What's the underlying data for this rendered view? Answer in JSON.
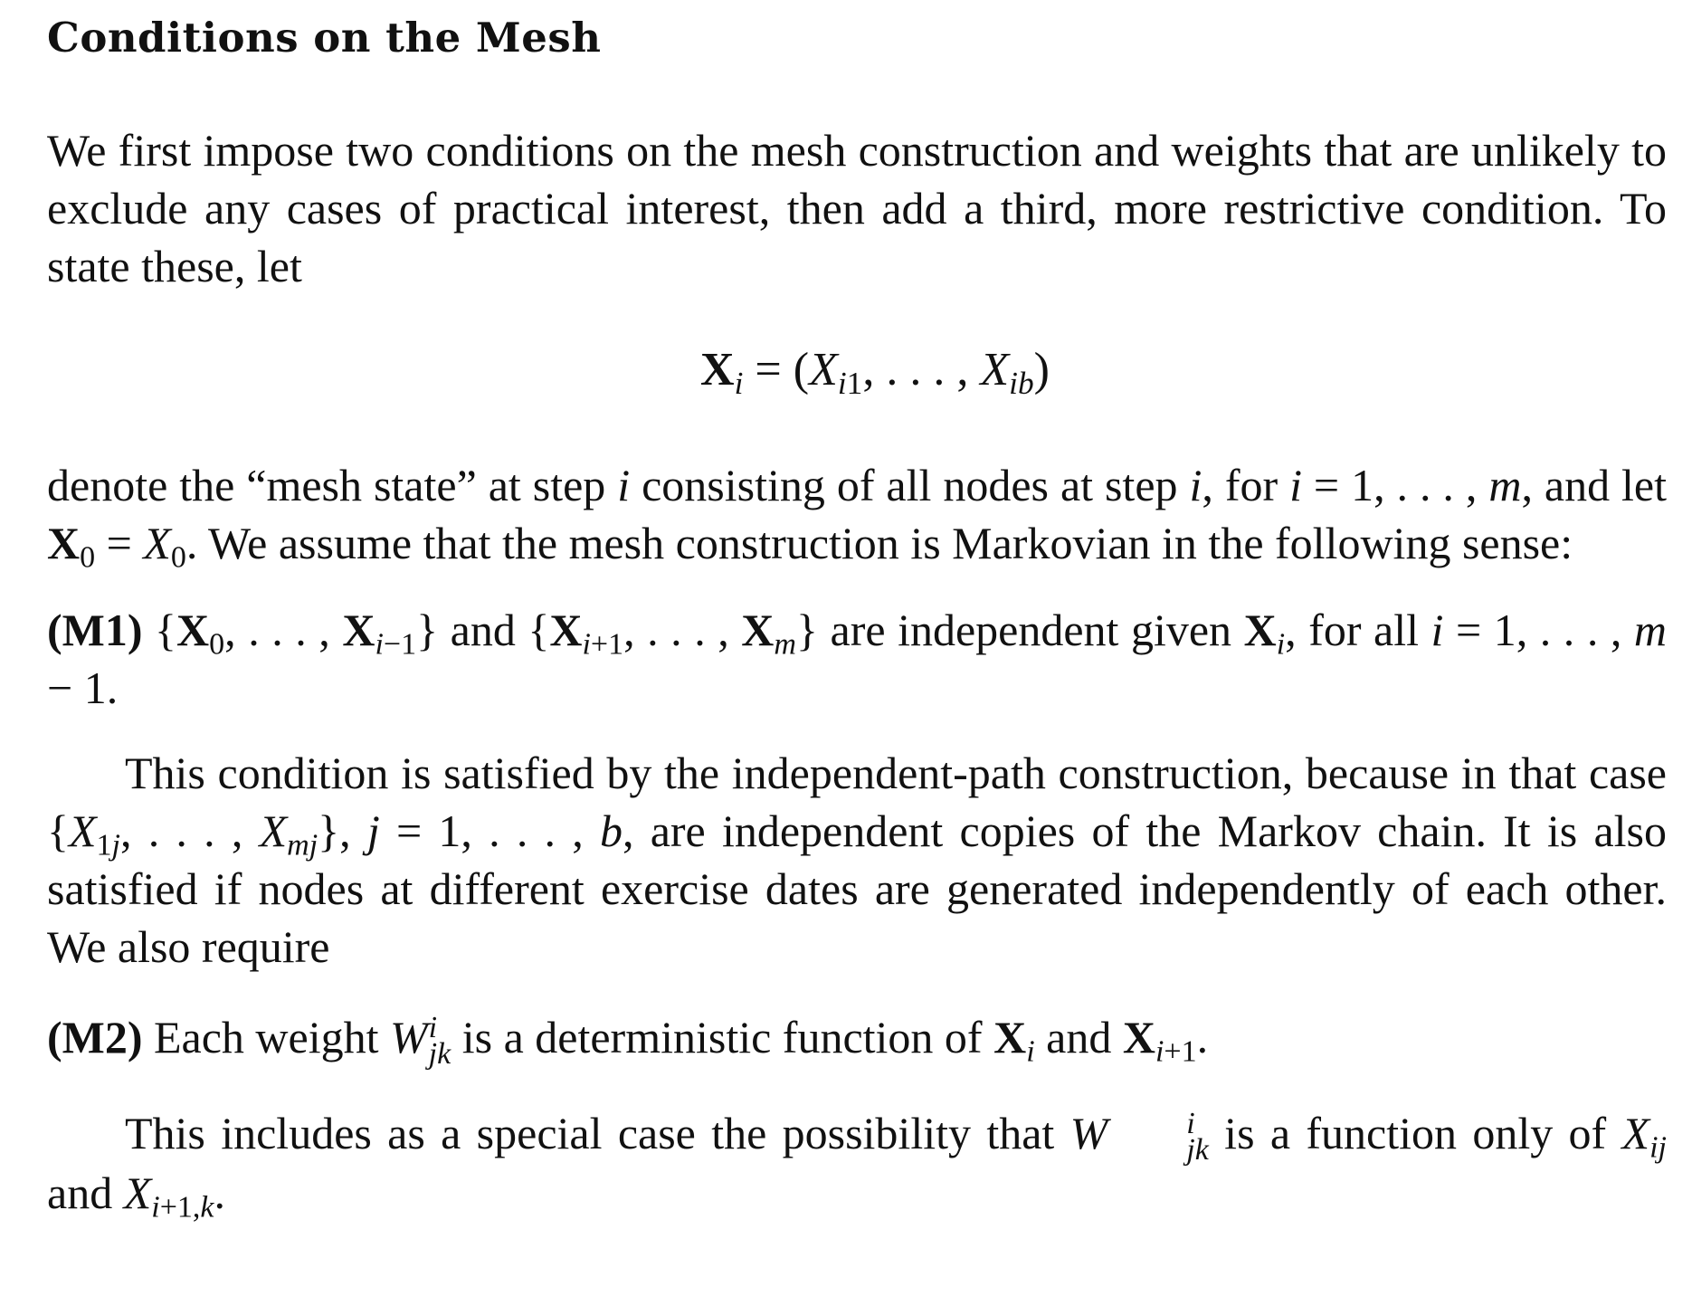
{
  "section_title": "Conditions on the Mesh",
  "paragraphs": {
    "intro": "We first impose two conditions on the mesh construction and weights that are unlikely to exclude any cases of practical interest, then add a third, more restrictive condition. To state these, let",
    "equation": "Xi = (Xi1, . . . , Xib)",
    "after_eq": "denote the “mesh state” at step i consisting of all nodes at step i, for i = 1, . . . , m, and let X0 = X0. We assume that the mesh construction is Markovian in the following sense:",
    "m1_label": "(M1)",
    "m1_text": "{X0, . . . , Xi−1} and {Xi+1, . . . , Xm} are independent given Xi, for all i = 1, . . . , m − 1.",
    "after_m1": "This condition is satisfied by the independent-path construction, because in that case {X1j, . . . , Xmj}, j = 1, . . . , b, are independent copies of the Markov chain. It is also satisfied if nodes at different exercise dates are generated independently of each other. We also require",
    "m2_label": "(M2)",
    "m2_text": "Each weight Wijk is a deterministic function of Xi and Xi+1.",
    "last": "This includes as a special case the possibility that Wijk is a function only of Xij and Xi+1,k."
  }
}
